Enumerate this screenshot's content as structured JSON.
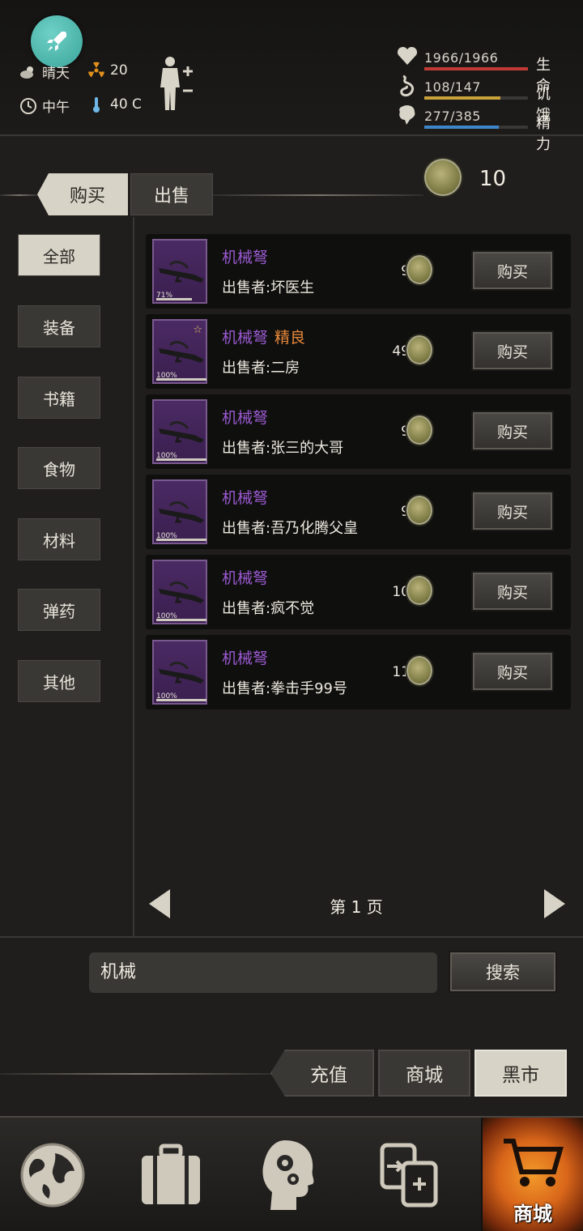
{
  "status": {
    "weather": "晴天",
    "radiation": "20",
    "time_of_day": "中午",
    "temperature": "40 C",
    "bars": [
      {
        "value": "1966/1966",
        "label": "生命",
        "fraction": 1.0,
        "color": "#c23a36"
      },
      {
        "value": "108/147",
        "label": "饥饿",
        "fraction": 0.735,
        "color": "#c9a23a"
      },
      {
        "value": "277/385",
        "label": "精力",
        "fraction": 0.72,
        "color": "#3f86c8"
      }
    ]
  },
  "trade_tabs": {
    "buy": "购买",
    "sell": "出售"
  },
  "currency": {
    "amount": "10"
  },
  "categories": [
    "全部",
    "装备",
    "书籍",
    "食物",
    "材料",
    "弹药",
    "其他"
  ],
  "listings": [
    {
      "name": "机械弩",
      "quality": "",
      "seller": "出售者:坏医生",
      "price": "9",
      "durability": "71%",
      "durability_fraction": 0.71,
      "starred": false,
      "buy": "购买"
    },
    {
      "name": "机械弩",
      "quality": "精良",
      "seller": "出售者:二房",
      "price": "49",
      "durability": "100%",
      "durability_fraction": 1.0,
      "starred": true,
      "buy": "购买"
    },
    {
      "name": "机械弩",
      "quality": "",
      "seller": "出售者:张三的大哥",
      "price": "9",
      "durability": "100%",
      "durability_fraction": 1.0,
      "starred": false,
      "buy": "购买"
    },
    {
      "name": "机械弩",
      "quality": "",
      "seller": "出售者:吾乃化腾父皇",
      "price": "9",
      "durability": "100%",
      "durability_fraction": 1.0,
      "starred": false,
      "buy": "购买"
    },
    {
      "name": "机械弩",
      "quality": "",
      "seller": "出售者:疯不觉",
      "price": "10",
      "durability": "100%",
      "durability_fraction": 1.0,
      "starred": false,
      "buy": "购买"
    },
    {
      "name": "机械弩",
      "quality": "",
      "seller": "出售者:拳击手99号",
      "price": "11",
      "durability": "100%",
      "durability_fraction": 1.0,
      "starred": false,
      "buy": "购买"
    }
  ],
  "pager": {
    "label": "第 1 页"
  },
  "search": {
    "value": "机械",
    "button": "搜索"
  },
  "shop_tabs": {
    "recharge": "充值",
    "mall": "商城",
    "black_market": "黑市"
  },
  "bottom_nav": {
    "active_label": "商城"
  }
}
